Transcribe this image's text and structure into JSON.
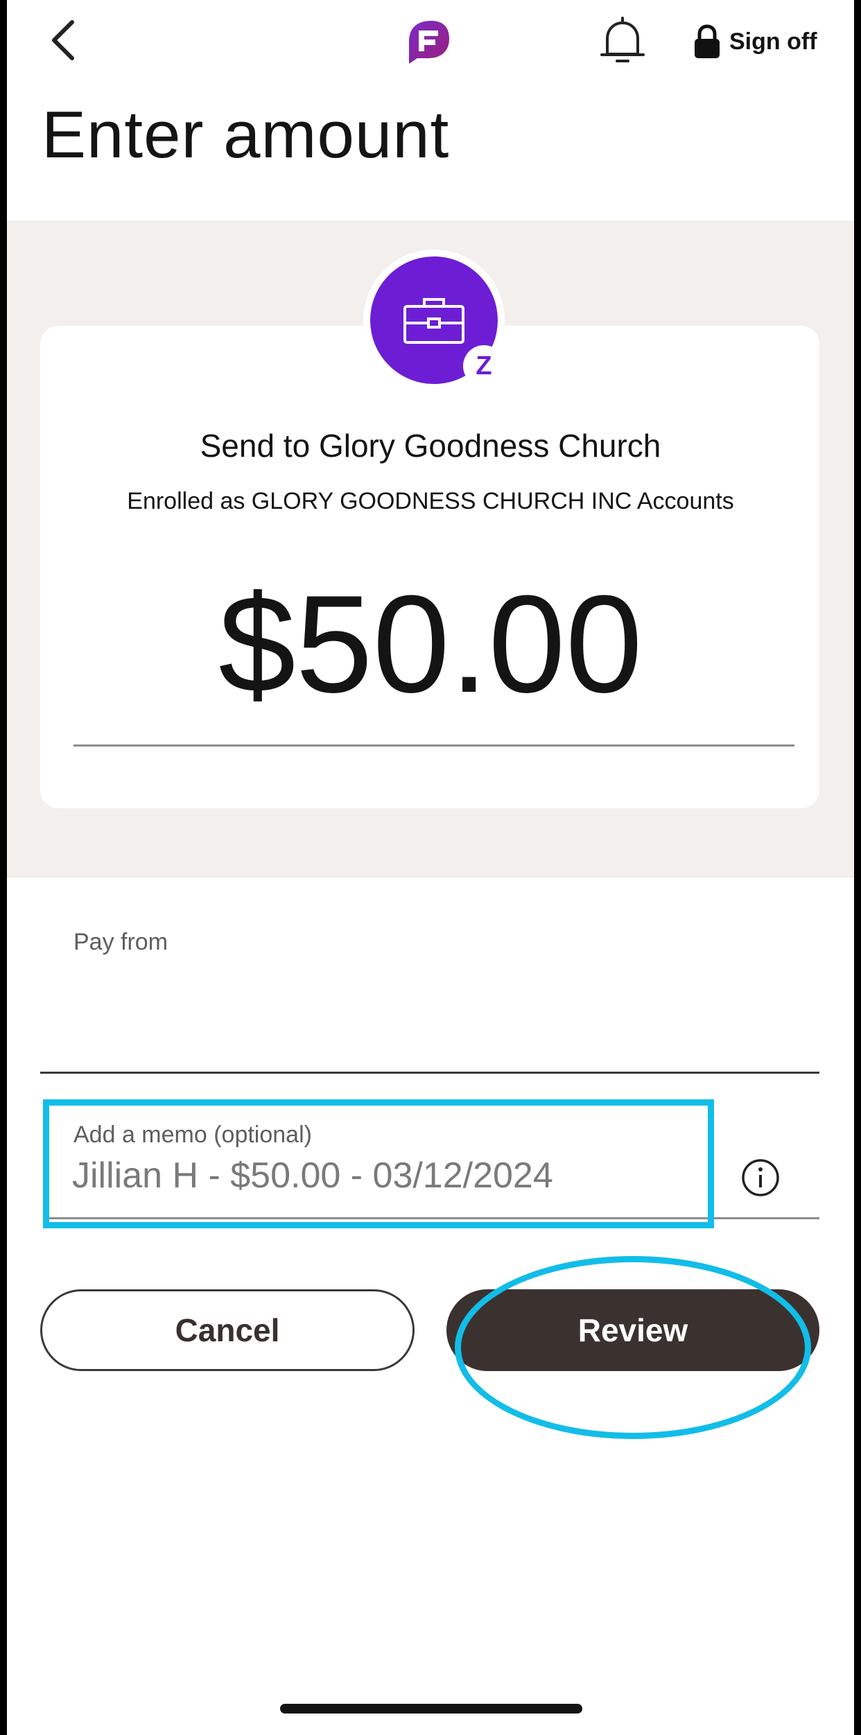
{
  "header": {
    "title": "Enter amount",
    "sign_off_label": "Sign off",
    "icons": {
      "back": "chevron-left-icon",
      "logo": "app-logo",
      "notifications": "bell-icon",
      "lock": "lock-icon"
    }
  },
  "recipient": {
    "icon": "briefcase-icon",
    "badge": "Z",
    "send_to": "Send to Glory Goodness Church",
    "enrolled_as": "Enrolled as GLORY GOODNESS CHURCH INC Accounts",
    "amount": "$50.00"
  },
  "pay_from": {
    "label": "Pay from",
    "value": ""
  },
  "memo": {
    "label": "Add a memo (optional)",
    "value": "Jillian H - $50.00 - 03/12/2024",
    "info_icon": "info-icon"
  },
  "actions": {
    "cancel_label": "Cancel",
    "review_label": "Review"
  },
  "colors": {
    "accent_purple": "#6d1ed4",
    "primary_button": "#3b3230",
    "annotation_highlight": "#12bde8",
    "band_background": "#f2efec"
  }
}
